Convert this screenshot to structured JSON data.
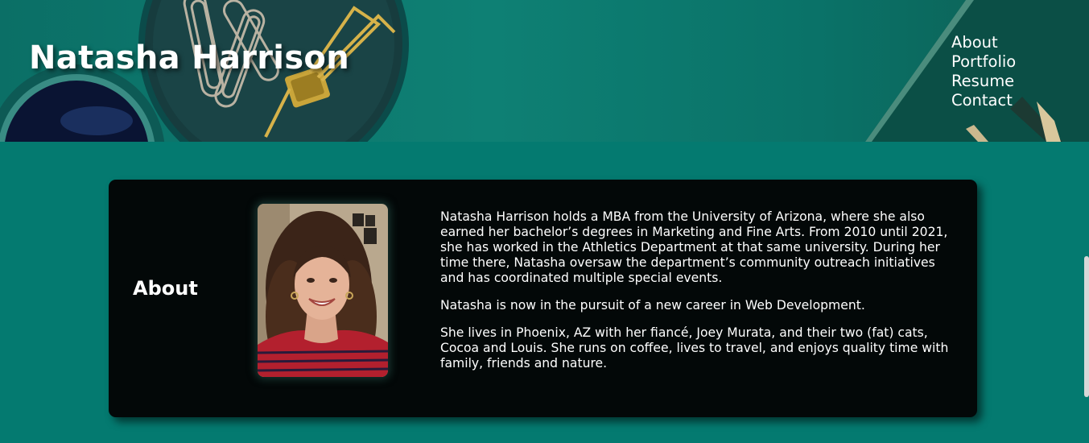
{
  "header": {
    "title": "Natasha Harrison"
  },
  "nav": {
    "items": [
      {
        "label": "About"
      },
      {
        "label": "Portfolio"
      },
      {
        "label": "Resume"
      },
      {
        "label": "Contact"
      }
    ]
  },
  "about": {
    "heading": "About",
    "paragraphs": [
      "Natasha Harrison holds a MBA from the University of Arizona, where she also earned her bachelor’s degrees in Marketing and Fine Arts. From 2010 until 2021, she has worked in the Athletics Department at that same university. During her time there, Natasha oversaw the department’s community outreach initiatives and has coordinated multiple special events.",
      "Natasha is now in the pursuit of a new career in Web Development.",
      "She lives in Phoenix, AZ with her fiancé, Joey Murata, and their two (fat) cats, Cocoa and Louis. She runs on coffee, lives to travel, and enjoys quality time with family, friends and nature."
    ]
  },
  "colors": {
    "page_background": "#047a70",
    "card_background": "#030808",
    "text": "#ffffff"
  }
}
